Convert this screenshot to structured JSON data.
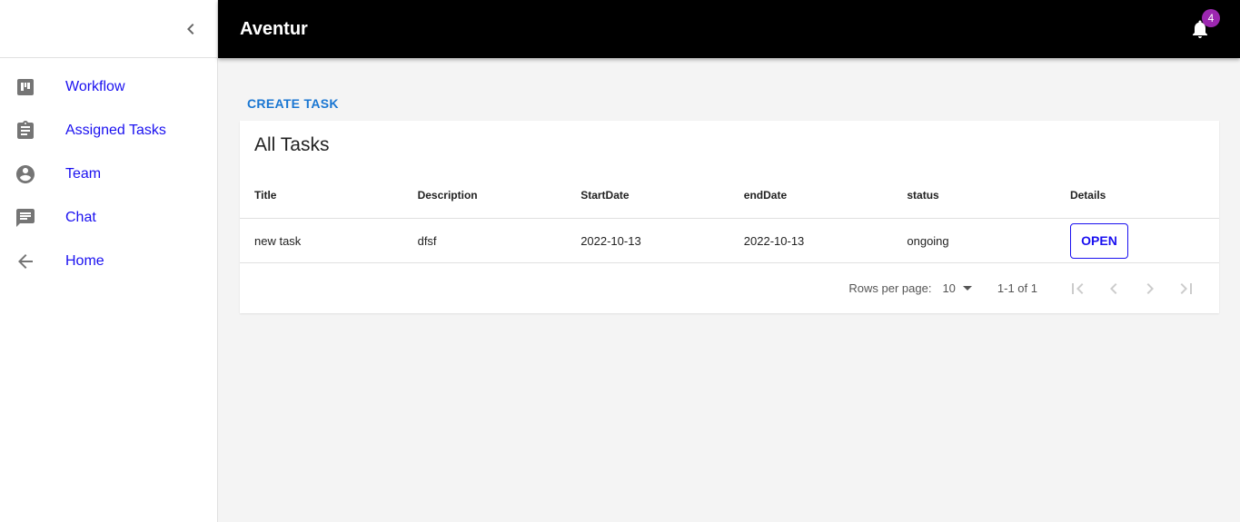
{
  "app": {
    "title": "Aventur",
    "notification_count": "4"
  },
  "sidebar": {
    "items": [
      {
        "label": "Workflow",
        "icon": "workflow-icon"
      },
      {
        "label": "Assigned Tasks",
        "icon": "clipboard-icon"
      },
      {
        "label": "Team",
        "icon": "account-circle-icon"
      },
      {
        "label": "Chat",
        "icon": "chat-icon"
      },
      {
        "label": "Home",
        "icon": "arrow-back-icon"
      }
    ]
  },
  "main": {
    "create_label": "CREATE TASK",
    "card_title": "All Tasks",
    "columns": [
      "Title",
      "Description",
      "StartDate",
      "endDate",
      "status",
      "Details"
    ],
    "rows": [
      {
        "title": "new task",
        "description": "dfsf",
        "start": "2022-10-13",
        "end": "2022-10-13",
        "status": "ongoing",
        "action": "OPEN"
      }
    ],
    "pagination": {
      "rows_per_page_label": "Rows per page:",
      "rows_per_page": "10",
      "range": "1-1 of 1"
    }
  },
  "colors": {
    "link": "#1a10f0",
    "accent": "#1976d2",
    "badge": "#9c27b0",
    "appbar": "#000000"
  }
}
